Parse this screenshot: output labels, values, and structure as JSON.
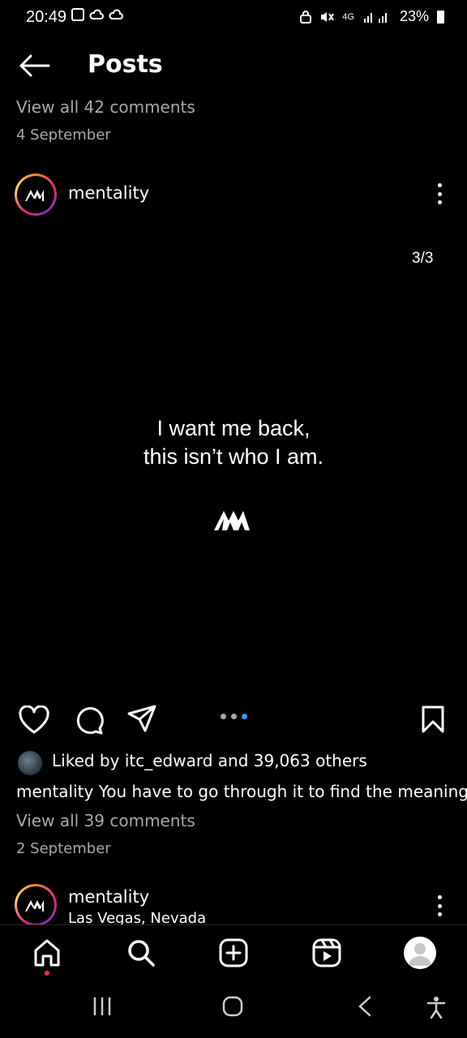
{
  "status_bar": {
    "time": "20:49",
    "network": "4G",
    "battery": "23%"
  },
  "header": {
    "title": "Posts",
    "back_icon": "arrow-left-icon"
  },
  "previous_post": {
    "view_comments": "View all 42 comments",
    "date": "4 September"
  },
  "post": {
    "username": "mentality",
    "counter": "3/3",
    "image_text": [
      "I want me back,",
      "this isn’t who I am."
    ],
    "likes_prefix": "Liked by ",
    "liker": "itc_edward",
    "likes_suffix": " and 39,063 others",
    "caption_user": "mentality",
    "caption": " You have to go through it to find the meaning.",
    "view_comments": "View all 39 comments",
    "date": "2 September",
    "carousel": {
      "count": 3,
      "active": 3
    }
  },
  "next_post": {
    "username": "mentality",
    "location": "Las Vegas, Nevada"
  },
  "bottom_nav": [
    "home-icon",
    "search-icon",
    "add-post-icon",
    "reels-icon",
    "profile-icon"
  ],
  "system_nav": [
    "recent-apps-icon",
    "home-button-icon",
    "back-icon",
    "accessibility-icon"
  ],
  "colors": {
    "accent_blue": "#3897f0",
    "notification_red": "#ff3040",
    "muted_text": "#a8a8a8"
  }
}
